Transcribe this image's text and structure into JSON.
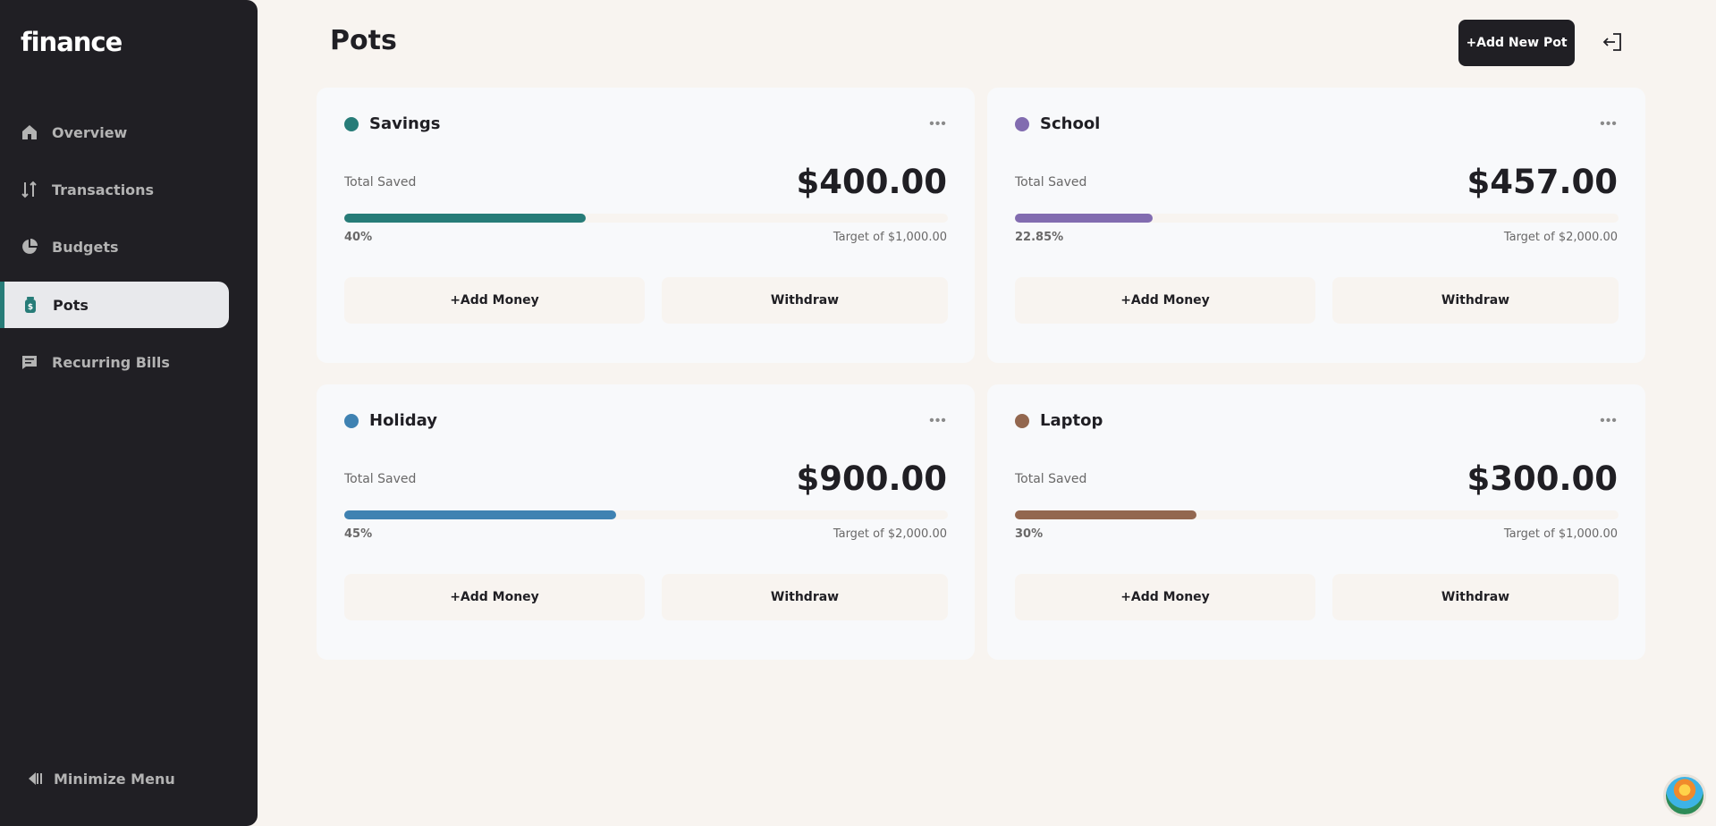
{
  "sidebar": {
    "logo": "finance",
    "items": [
      {
        "label": "Overview",
        "icon": "home-icon"
      },
      {
        "label": "Transactions",
        "icon": "arrows-updown-icon"
      },
      {
        "label": "Budgets",
        "icon": "pie-chart-icon"
      },
      {
        "label": "Pots",
        "icon": "jar-icon"
      },
      {
        "label": "Recurring Bills",
        "icon": "receipt-icon"
      }
    ],
    "active": "Pots",
    "minimize_label": "Minimize Menu"
  },
  "header": {
    "title": "Pots",
    "add_button": "+Add New Pot"
  },
  "pots": [
    {
      "name": "Savings",
      "color": "#277c78",
      "total_label": "Total Saved",
      "amount": "$400.00",
      "percent_label": "40%",
      "progress": 0.4,
      "target": "Target of $1,000.00",
      "add_label": "+Add Money",
      "withdraw_label": "Withdraw"
    },
    {
      "name": "School",
      "color": "#826cb0",
      "total_label": "Total Saved",
      "amount": "$457.00",
      "percent_label": "22.85%",
      "progress": 0.2285,
      "target": "Target of $2,000.00",
      "add_label": "+Add Money",
      "withdraw_label": "Withdraw"
    },
    {
      "name": "Holiday",
      "color": "#3f82b2",
      "total_label": "Total Saved",
      "amount": "$900.00",
      "percent_label": "45%",
      "progress": 0.45,
      "target": "Target of $2,000.00",
      "add_label": "+Add Money",
      "withdraw_label": "Withdraw"
    },
    {
      "name": "Laptop",
      "color": "#93674f",
      "total_label": "Total Saved",
      "amount": "$300.00",
      "percent_label": "30%",
      "progress": 0.3,
      "target": "Target of $1,000.00",
      "add_label": "+Add Money",
      "withdraw_label": "Withdraw"
    }
  ]
}
